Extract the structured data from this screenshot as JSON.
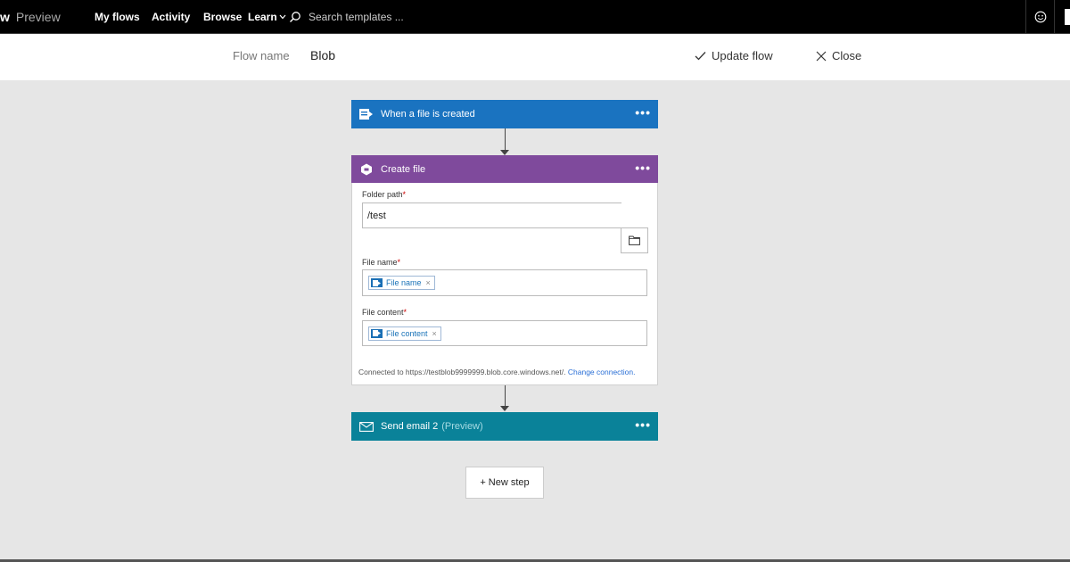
{
  "nav": {
    "brand_letter": "w",
    "brand_preview": "Preview",
    "items": [
      {
        "label": "My flows"
      },
      {
        "label": "Activity"
      },
      {
        "label": "Browse"
      },
      {
        "label": "Learn"
      }
    ],
    "search_placeholder": "Search templates ...",
    "search_icon": "search-icon",
    "feedback_icon": "smiley-icon"
  },
  "header": {
    "flow_name_label": "Flow name",
    "flow_name_value": "Blob",
    "update_label": "Update flow",
    "close_label": "Close"
  },
  "steps": {
    "trigger": {
      "title": "When a file is created",
      "color": "#1a73c0"
    },
    "create_file": {
      "title": "Create file",
      "color": "#7f4a9c",
      "folder_path_label": "Folder path",
      "folder_path_value": "/test",
      "file_name_label": "File name",
      "file_name_token": "File name",
      "file_content_label": "File content",
      "file_content_token": "File content",
      "required_mark": "*",
      "connection_text": "Connected to https://testblob9999999.blob.core.windows.net/.",
      "change_connection": "Change connection."
    },
    "send_email": {
      "title": "Send email 2",
      "suffix": "(Preview)",
      "color": "#0a8299"
    }
  },
  "new_step_label": "+ New step",
  "more_glyph": "•••"
}
